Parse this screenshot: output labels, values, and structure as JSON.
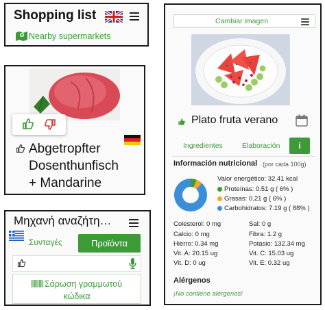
{
  "colors": {
    "accent": "#3d9a38",
    "protein": "#3d9a38",
    "fat": "#f5a623",
    "carbs": "#3b8ed8"
  },
  "shopping": {
    "title": "Shopping list",
    "flag_icon": "uk-flag-icon",
    "menu_icon": "hamburger-menu-icon",
    "nearby_label": "Nearby supermarkets",
    "nearby_icon": "map-pin-icon"
  },
  "product": {
    "name_line1": "Abgetropfter",
    "name_line2": "Dosenthunfisch",
    "name_line3": "+ Mandarine",
    "flag_icon": "germany-flag-icon",
    "vote_icons": [
      "thumbs-up-icon",
      "thumbs-down-icon"
    ]
  },
  "search": {
    "title": "Μηχανή αναζήτη…",
    "flag_icon": "greece-flag-icon",
    "tab_recipes": "Συνταγές",
    "tab_products": "Προϊόντα",
    "mic_icon": "microphone-icon",
    "barcode_line1": "Σάρωση γραμμωτού",
    "barcode_line2": "κώδικα"
  },
  "recipe": {
    "change_image": "Cambiar imagen",
    "name": "Plato fruta verano",
    "tabs": [
      "Ingredientes",
      "Elaboración",
      "i"
    ],
    "nutrition_title": "Información nutricional",
    "per_unit": "(por cada 100g)",
    "energy": "Valor energético: 32.41 kcal",
    "macros": [
      {
        "label": "Proteínas: 0.51 g ( 6% )",
        "percent": 6
      },
      {
        "label": "Grasas: 0.21 g ( 6% )",
        "percent": 6
      },
      {
        "label": "Carbohidratos: 7.19 g ( 88% )",
        "percent": 88
      }
    ],
    "micros_left": [
      "Colesterol: 0 mg",
      "Calcio: 0 mg",
      "Hierro: 0.34 mg",
      "Vit. A: 20.15 ug",
      "Vit. D: 0 ug"
    ],
    "micros_right": [
      "Sal: 0 g",
      "Fibra: 1.2 g",
      "Potasio: 132.34 mg",
      "Vit. C: 15.03 ug",
      "Vit. E: 0.32 ug"
    ],
    "allergens_title": "Alérgenos",
    "allergens_value": "¡No contiene alérgenos!"
  }
}
